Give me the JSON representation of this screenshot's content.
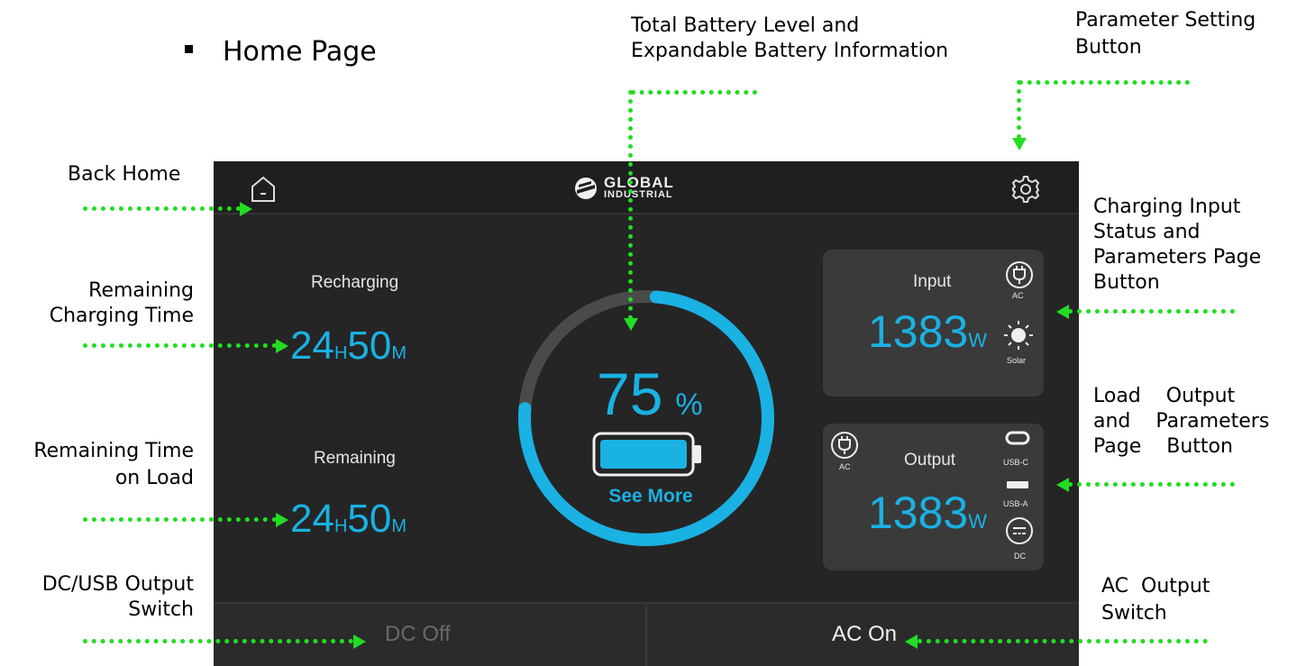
{
  "page": {
    "heading": "Home Page"
  },
  "annotations": {
    "total_battery": "Total Battery Level and",
    "total_battery_2": "Expandable Battery Information",
    "param_setting": "Parameter Setting",
    "param_setting_2": "Button",
    "back_home": "Back Home",
    "charging_input": "Charging Input",
    "charging_input_2": "Status and",
    "charging_input_3": "Parameters Page",
    "charging_input_4": "Button",
    "remaining_charging": "Remaining",
    "remaining_charging_2": "Charging Time",
    "load_output": "Load    Output",
    "load_output_2": "and    Parameters",
    "load_output_3": "Page    Button",
    "remaining_load": "Remaining Time",
    "remaining_load_2": "on Load",
    "dc_usb": "DC/USB Output",
    "dc_usb_2": "Switch",
    "ac_output": "AC  Output",
    "ac_output_2": "Switch"
  },
  "topbar": {
    "logo_line1": "GLOBAL",
    "logo_line2": "INDUSTRIAL",
    "home_icon": "home-icon",
    "settings_icon": "gear-icon"
  },
  "left": {
    "recharging_label": "Recharging",
    "recharging_h": "24",
    "recharging_h_unit": "H",
    "recharging_m": "50",
    "recharging_m_unit": "M",
    "remaining_label": "Remaining",
    "remaining_h": "24",
    "remaining_h_unit": "H",
    "remaining_m": "50",
    "remaining_m_unit": "M"
  },
  "battery": {
    "percent": "75",
    "percent_sign": "%",
    "level": 0.75,
    "see_more": "See More"
  },
  "input_panel": {
    "title": "Input",
    "value": "1383",
    "unit": "W",
    "ac_label": "AC",
    "solar_label": "Solar"
  },
  "output_panel": {
    "title": "Output",
    "value": "1383",
    "unit": "W",
    "ac_label": "AC",
    "usbc_label": "USB-C",
    "usba_label": "USB-A",
    "dc_label": "DC"
  },
  "switches": {
    "dc": "DC Off",
    "ac": "AC On"
  },
  "colors": {
    "accent": "#1ab1e3",
    "pointer": "#22dd22"
  }
}
